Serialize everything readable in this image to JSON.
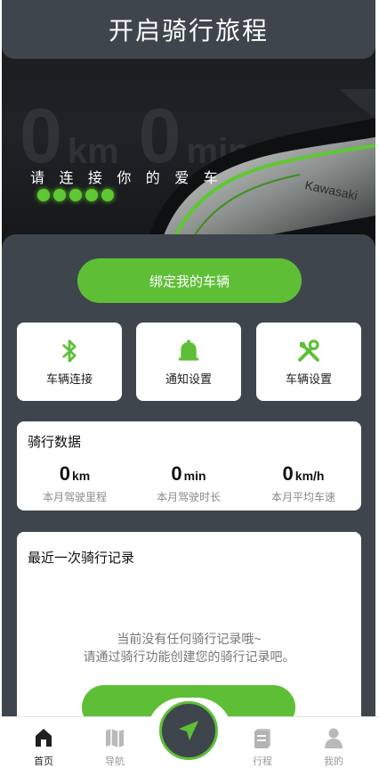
{
  "header": {
    "title": "开启骑行旅程"
  },
  "hero": {
    "tagline": "请 连 接 你 的 爱 车",
    "watermark": {
      "speed": "0",
      "speed_unit": "km",
      "time": "0",
      "time_unit": "min"
    },
    "dots_lit": 5
  },
  "bind_button": {
    "label": "绑定我的车辆"
  },
  "quick_actions": [
    {
      "label": "车辆连接",
      "icon": "bluetooth-icon"
    },
    {
      "label": "通知设置",
      "icon": "bell-icon"
    },
    {
      "label": "车辆设置",
      "icon": "tools-icon"
    }
  ],
  "ride_stats": {
    "title": "骑行数据",
    "items": [
      {
        "value": "0",
        "unit": "km",
        "label": "本月驾驶里程"
      },
      {
        "value": "0",
        "unit": "min",
        "label": "本月驾驶时长"
      },
      {
        "value": "0",
        "unit": "km/h",
        "label": "本月平均车速"
      }
    ]
  },
  "recent_record": {
    "title": "最近一次骑行记录",
    "empty_line1": "当前没有任何骑行记录哦~",
    "empty_line2": "请通过骑行功能创建您的骑行记录吧。"
  },
  "tabbar": {
    "items": [
      {
        "label": "首页",
        "icon": "home-icon",
        "active": true
      },
      {
        "label": "导航",
        "icon": "map-icon",
        "active": false
      },
      {
        "label": "行程",
        "icon": "trip-icon",
        "active": false
      },
      {
        "label": "我的",
        "icon": "user-icon",
        "active": false
      }
    ],
    "center_icon": "navigate-arrow-icon"
  },
  "colors": {
    "accent": "#5ebf37",
    "dark_panel": "#3f454c",
    "background": "#ffffff"
  }
}
